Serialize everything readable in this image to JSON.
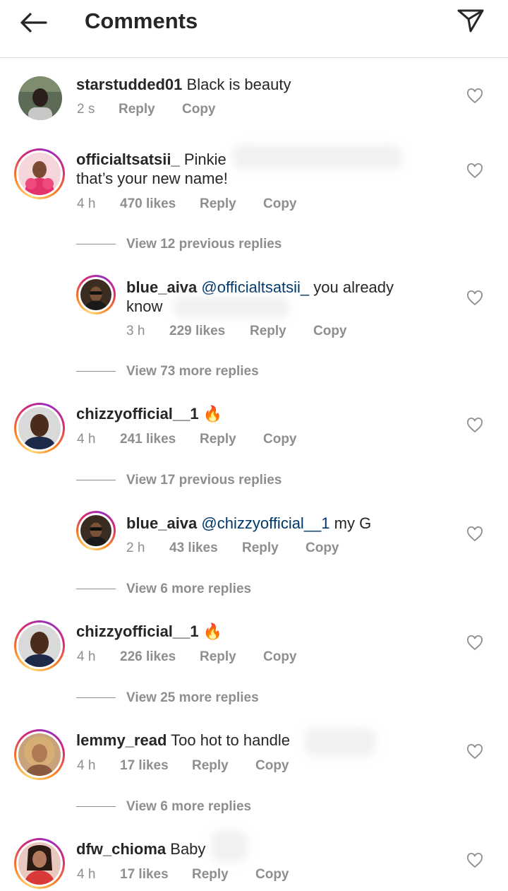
{
  "header": {
    "title": "Comments",
    "back_icon": "back-arrow-icon",
    "send_icon": "paper-plane-icon"
  },
  "comments": [
    {
      "user": "starstudded01",
      "text": "Black is beauty",
      "time": "2 s",
      "likes": "",
      "reply": "Reply",
      "copy": "Copy"
    },
    {
      "user": "officialtsatsii_",
      "text": "Pinkie",
      "text2": "that’s your new name!",
      "time": "4 h",
      "likes": "470 likes",
      "reply": "Reply",
      "copy": "Copy"
    },
    {
      "view": "View 12 previous replies"
    },
    {
      "user": "blue_aiva",
      "mention": "@officialtsatsii_",
      "text": " you already",
      "text2": "know",
      "time": "3 h",
      "likes": "229 likes",
      "reply": "Reply",
      "copy": "Copy"
    },
    {
      "view": "View 73 more replies"
    },
    {
      "user": "chizzyofficial__1",
      "text": "🔥",
      "time": "4 h",
      "likes": "241 likes",
      "reply": "Reply",
      "copy": "Copy"
    },
    {
      "view": "View 17 previous replies"
    },
    {
      "user": "blue_aiva",
      "mention": "@chizzyofficial__1",
      "text": " my G",
      "time": "2 h",
      "likes": "43 likes",
      "reply": "Reply",
      "copy": "Copy"
    },
    {
      "view": "View 6 more replies"
    },
    {
      "user": "chizzyofficial__1",
      "text": "🔥",
      "time": "4 h",
      "likes": "226 likes",
      "reply": "Reply",
      "copy": "Copy"
    },
    {
      "view": "View 25 more replies"
    },
    {
      "user": "lemmy_read",
      "text": "Too hot to handle",
      "time": "4 h",
      "likes": "17 likes",
      "reply": "Reply",
      "copy": "Copy"
    },
    {
      "view": "View 6 more replies"
    },
    {
      "user": "dfw_chioma",
      "text": "Baby",
      "time": "4 h",
      "likes": "17 likes",
      "reply": "Reply",
      "copy": "Copy"
    }
  ],
  "colors": {
    "text": "#262626",
    "secondary": "#8e8e8e",
    "mention": "#00376b",
    "divider": "#dbdbdb"
  }
}
